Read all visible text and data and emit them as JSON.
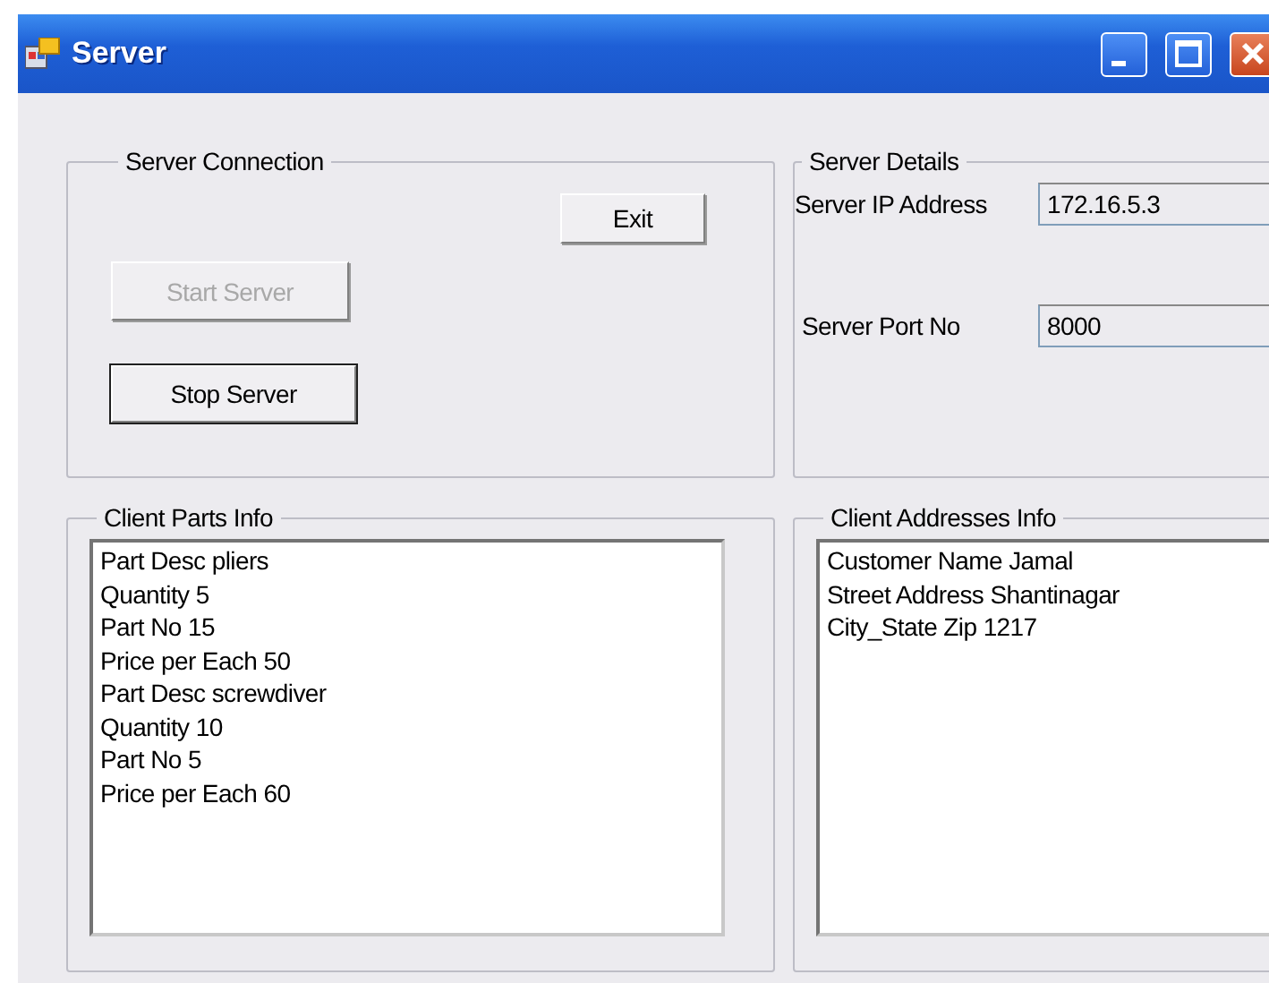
{
  "window": {
    "title": "Server"
  },
  "server_connection": {
    "title": "Server Connection",
    "buttons": [
      {
        "kind": "exit",
        "label": "Exit",
        "disabled": false,
        "default": false
      },
      {
        "kind": "start",
        "label": "Start Server",
        "disabled": true,
        "default": false
      },
      {
        "kind": "stop",
        "label": "Stop Server",
        "disabled": false,
        "default": true
      }
    ]
  },
  "server_details": {
    "title": "Server Details",
    "fields": [
      {
        "label": "Server IP Address",
        "value": "172.16.5.3"
      },
      {
        "label": "Server Port No",
        "value": "8000"
      }
    ]
  },
  "client_parts_info": {
    "title": "Client Parts Info",
    "lines": [
      "Part Desc pliers",
      "Quantity 5",
      "Part No 15",
      "Price per Each 50",
      "Part Desc screwdiver",
      "Quantity 10",
      "Part No 5",
      "Price per Each 60"
    ]
  },
  "client_addresses_info": {
    "title": "Client Addresses Info",
    "lines": [
      "Customer Name Jamal",
      "Street Address Shantinagar",
      "City_State Zip 1217"
    ]
  }
}
